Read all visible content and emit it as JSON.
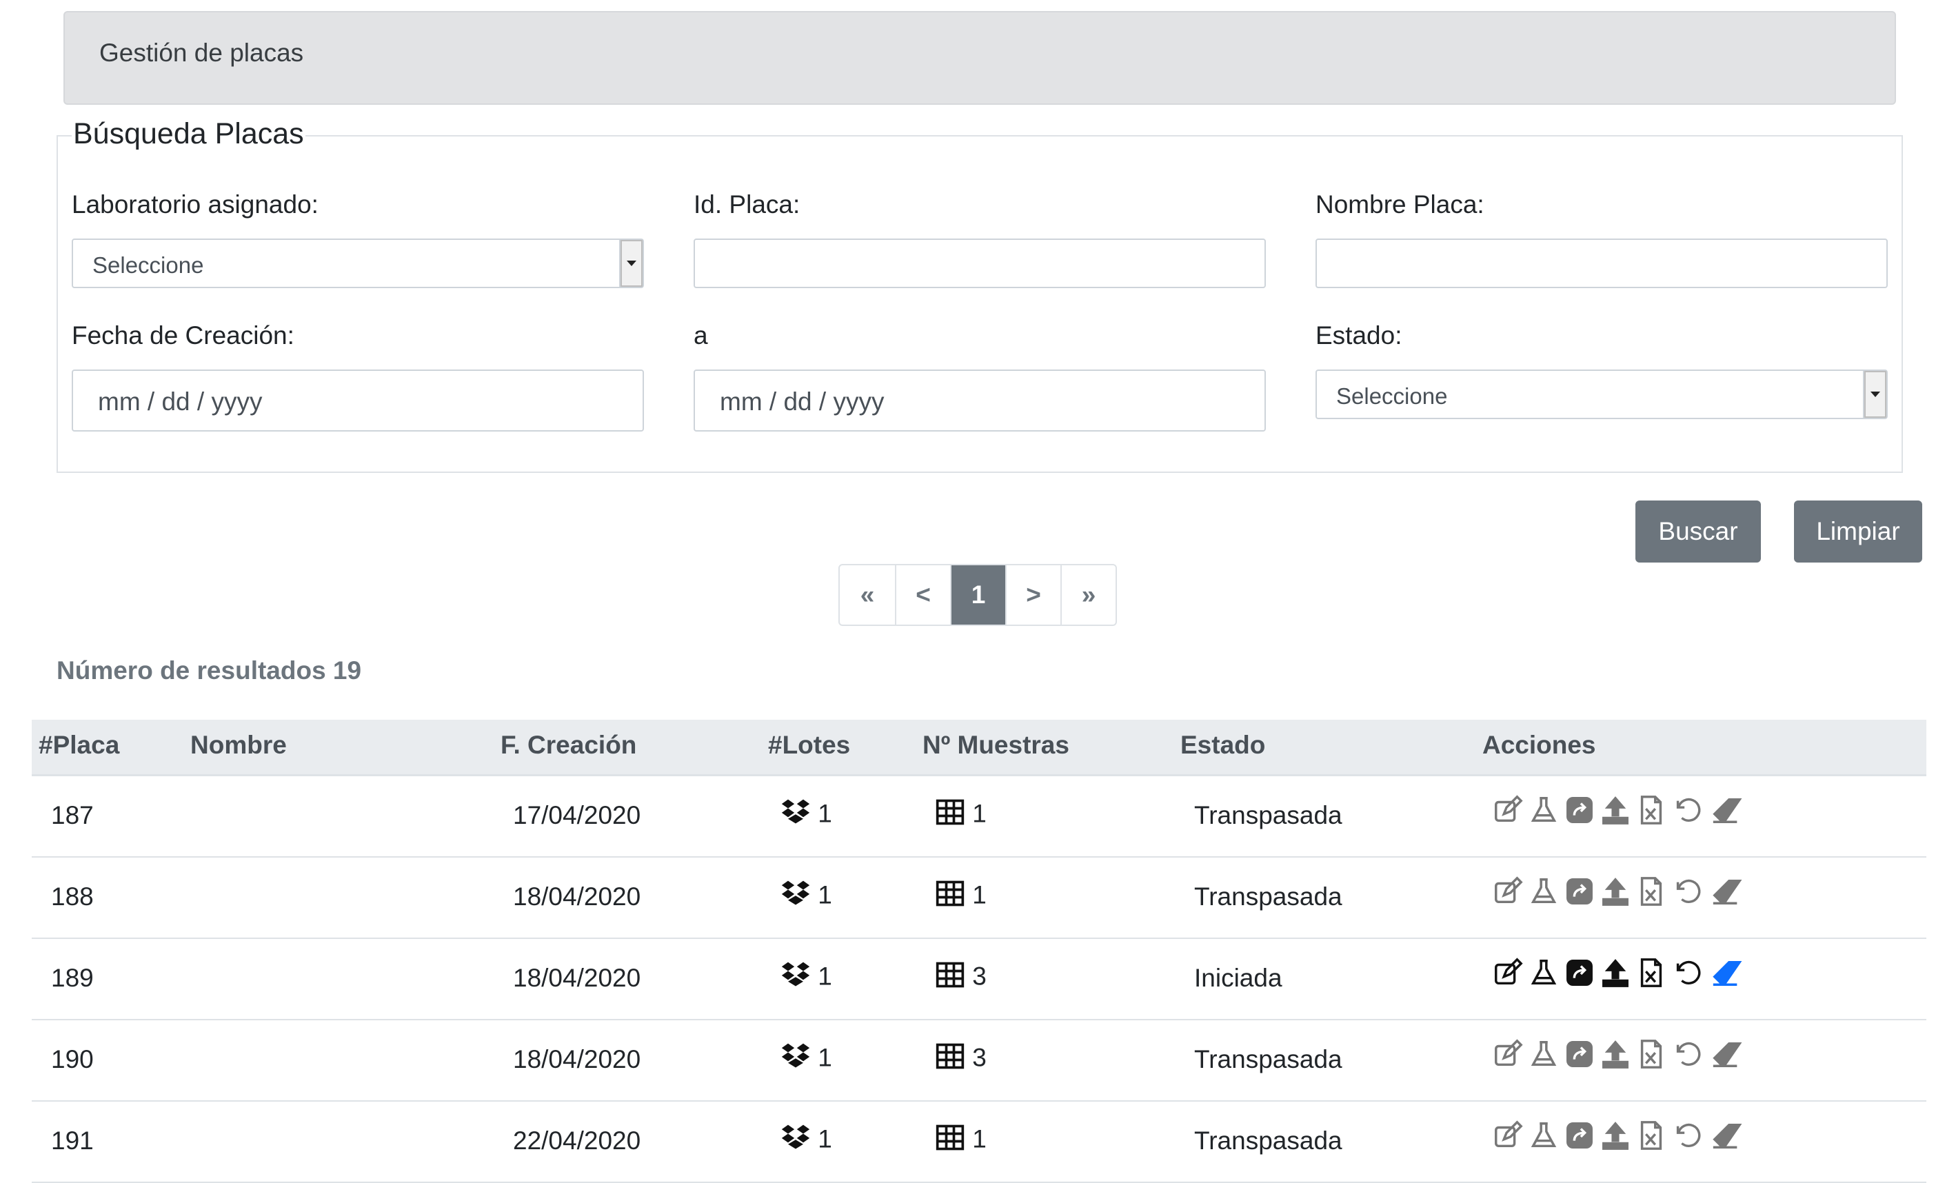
{
  "breadcrumb": "Gestión de placas",
  "search": {
    "legend": "Búsqueda Placas",
    "lab_label": "Laboratorio asignado:",
    "lab_value": "Seleccione",
    "id_label": "Id. Placa:",
    "name_label": "Nombre Placa:",
    "date_label": "Fecha de Creación:",
    "date_from": "mm / dd / yyyy",
    "to_label": "a",
    "date_to": "mm / dd / yyyy",
    "state_label": "Estado:",
    "state_value": "Seleccione"
  },
  "buttons": {
    "search": "Buscar",
    "clear": "Limpiar"
  },
  "pagination": {
    "first": "«",
    "prev": "<",
    "current": "1",
    "next": ">",
    "last": "»"
  },
  "results_label": "Número de resultados 19",
  "table": {
    "headers": [
      "#Placa",
      "Nombre",
      "F. Creación",
      "#Lotes",
      "Nº Muestras",
      "Estado",
      "Acciones"
    ],
    "rows": [
      {
        "id": "187",
        "name": "",
        "date": "17/04/2020",
        "lots": "1",
        "samples": "1",
        "state": "Transpasada",
        "active": false
      },
      {
        "id": "188",
        "name": "",
        "date": "18/04/2020",
        "lots": "1",
        "samples": "1",
        "state": "Transpasada",
        "active": false
      },
      {
        "id": "189",
        "name": "",
        "date": "18/04/2020",
        "lots": "1",
        "samples": "3",
        "state": "Iniciada",
        "active": true
      },
      {
        "id": "190",
        "name": "",
        "date": "18/04/2020",
        "lots": "1",
        "samples": "3",
        "state": "Transpasada",
        "active": false
      },
      {
        "id": "191",
        "name": "",
        "date": "22/04/2020",
        "lots": "1",
        "samples": "1",
        "state": "Transpasada",
        "active": false
      }
    ],
    "action_icons": [
      "edit-icon",
      "flask-icon",
      "share-icon",
      "upload-icon",
      "excel-icon",
      "undo-icon",
      "eraser-icon"
    ]
  },
  "colors": {
    "button": "#6c757d",
    "header_bg": "#e9ecef",
    "breadcrumb_bg": "#e2e3e5",
    "eraser_active": "#0d6efd",
    "icon_disabled": "#777777"
  }
}
